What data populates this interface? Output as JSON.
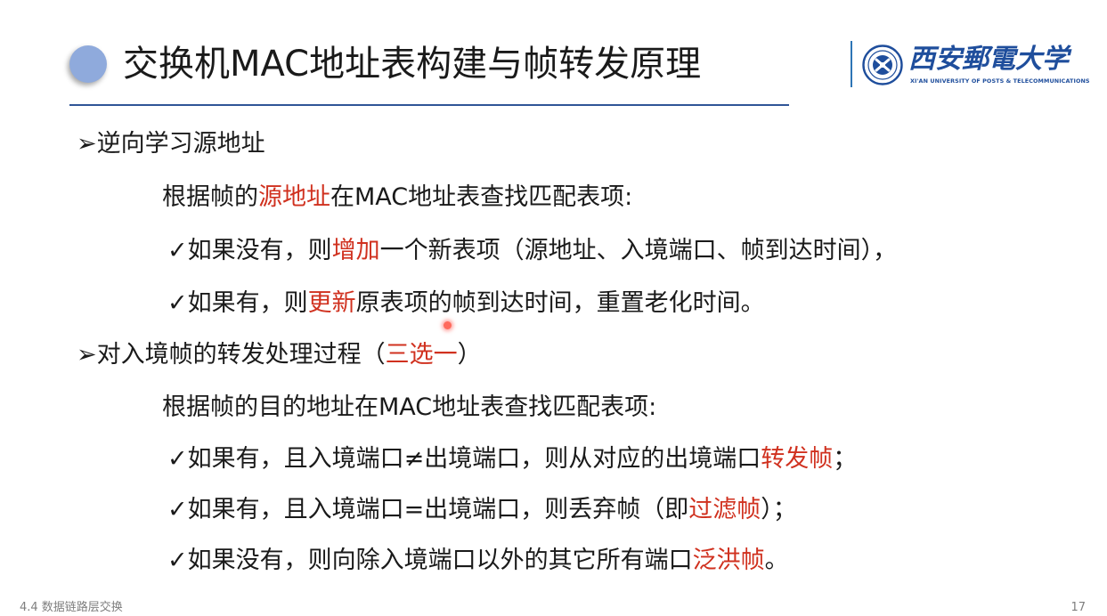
{
  "title": "交换机MAC地址表构建与帧转发原理",
  "logo": {
    "name": "西安郵電大学",
    "subtitle": "XI'AN UNIVERSITY OF POSTS & TELECOMMUNICATIONS",
    "color": "#1f4e9c"
  },
  "section1": {
    "marker": "➢",
    "heading": "逆向学习源地址",
    "intro": {
      "before": "根据帧的",
      "highlight": "源地址",
      "after": "在MAC地址表查找匹配表项:"
    },
    "items": [
      {
        "check": "✓",
        "before": "如果没有，则",
        "highlight": "增加",
        "after": "一个新表项（源地址、入境端口、帧到达时间），"
      },
      {
        "check": "✓",
        "before": "如果有，则",
        "highlight": "更新",
        "after": "原表项的帧到达时间，重置老化时间。"
      }
    ]
  },
  "section2": {
    "marker": "➢",
    "heading_before": "对入境帧的转发处理过程（",
    "heading_highlight": "三选一",
    "heading_after": "）",
    "intro": "根据帧的目的地址在MAC地址表查找匹配表项:",
    "items": [
      {
        "check": "✓",
        "before": "如果有，且入境端口≠出境端口，则从对应的出境端口",
        "highlight": "转发帧",
        "after": "；"
      },
      {
        "check": "✓",
        "before": "如果有，且入境端口=出境端口，则丢弃帧（即",
        "highlight": "过滤帧",
        "after": "）；"
      },
      {
        "check": "✓",
        "before": "如果没有，则向除入境端口以外的其它所有端口",
        "highlight": "泛洪帧",
        "after": "。"
      }
    ]
  },
  "footer": {
    "section_label": "4.4 数据链路层交换",
    "page_number": "17"
  },
  "colors": {
    "highlight": "#d0311f",
    "accent_line": "#2f5597",
    "title_bullet": "#8faadc"
  }
}
